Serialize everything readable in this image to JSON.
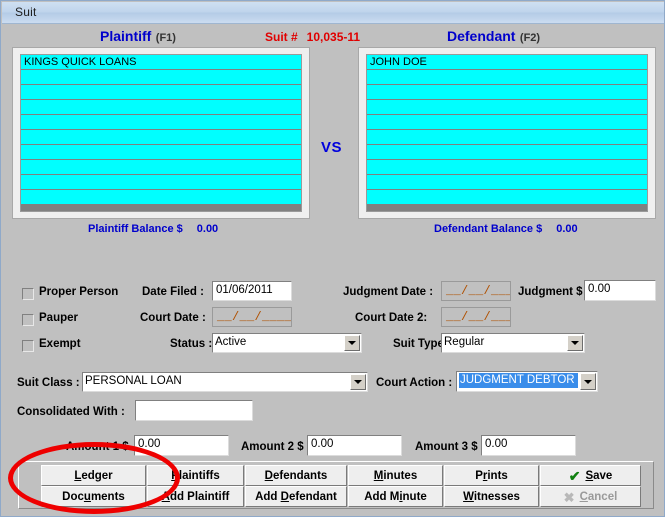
{
  "window": {
    "title": "Suit"
  },
  "header": {
    "plaintiff_label": "Plaintiff",
    "plaintiff_key": "(F1)",
    "defendant_label": "Defendant",
    "defendant_key": "(F2)",
    "suit_number_label": "Suit #",
    "suit_number": "10,035-11",
    "vs": "VS"
  },
  "plaintiffs": {
    "rows": [
      "KINGS QUICK LOANS",
      "",
      "",
      "",
      "",
      "",
      "",
      "",
      "",
      ""
    ],
    "balance_label": "Plaintiff Balance $",
    "balance_value": "0.00"
  },
  "defendants": {
    "rows": [
      "JOHN DOE",
      "",
      "",
      "",
      "",
      "",
      "",
      "",
      "",
      ""
    ],
    "balance_label": "Defendant Balance $",
    "balance_value": "0.00"
  },
  "form": {
    "proper_person_label": "Proper Person",
    "pauper_label": "Pauper",
    "exempt_label": "Exempt",
    "date_filed_label": "Date Filed :",
    "date_filed_value": "01/06/2011",
    "court_date_label": "Court Date :",
    "court_date_value": "__/__/____",
    "status_label": "Status :",
    "status_value": "Active",
    "judgment_date_label": "Judgment Date :",
    "judgment_date_value": "__/__/____",
    "judgment_amount_label": "Judgment $",
    "judgment_amount_value": "0.00",
    "court_date2_label": "Court Date 2:",
    "court_date2_value": "__/__/____",
    "suit_type_label": "Suit Type :",
    "suit_type_value": "Regular",
    "suit_class_label": "Suit Class :",
    "suit_class_value": "PERSONAL LOAN",
    "court_action_label": "Court Action :",
    "court_action_value": "JUDGMENT DEBTOR",
    "consolidated_label": "Consolidated With :",
    "consolidated_value": "",
    "amount1_label": "Amount 1 $",
    "amount1_value": "0.00",
    "amount2_label": "Amount 2 $",
    "amount2_value": "0.00",
    "amount3_label": "Amount 3 $",
    "amount3_value": "0.00"
  },
  "buttons": {
    "ledger": "Ledger",
    "documents": "Documents",
    "plaintiffs": "Plaintiffs",
    "add_plaintiff": "Add Plaintiff",
    "defendants": "Defendants",
    "add_defendant": "Add Defendant",
    "minutes": "Minutes",
    "add_minute": "Add Minute",
    "prints": "Prints",
    "witnesses": "Witnesses",
    "save": "Save",
    "cancel": "Cancel",
    "save_icon": "check-icon",
    "cancel_icon": "cancel-x-icon"
  },
  "annotation": {
    "shape": "red-ellipse-highlight",
    "color": "#ee0000"
  }
}
